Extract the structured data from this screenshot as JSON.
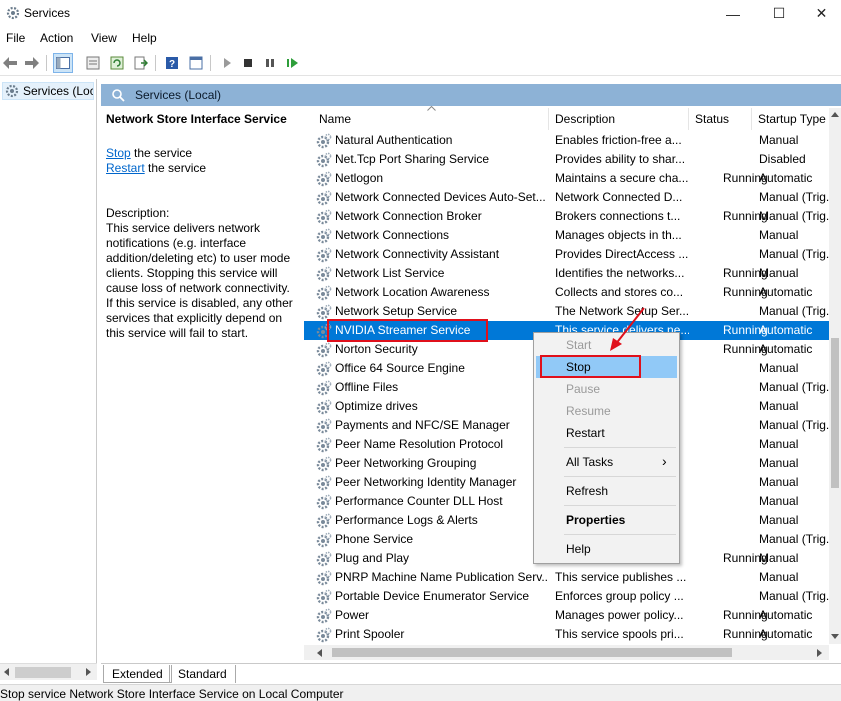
{
  "window": {
    "title": "Services",
    "minimize_glyph": "—",
    "maximize_glyph": "☐",
    "close_glyph": "✕"
  },
  "menu": [
    "File",
    "Action",
    "View",
    "Help"
  ],
  "toolbar": {
    "icons": [
      "back-icon",
      "forward-icon",
      "show-console-tree-icon",
      "properties-icon",
      "refresh-icon",
      "export-list-icon",
      "help-icon",
      "view-icon",
      "start-service-icon",
      "stop-service-icon",
      "pause-service-icon",
      "restart-service-icon"
    ]
  },
  "tree": {
    "item": "Services (Local)"
  },
  "pane_header": {
    "label": "Services (Local)"
  },
  "description": {
    "service_title": "Network Store Interface Service",
    "stop_link": "Stop",
    "stop_suffix": " the service",
    "restart_link": "Restart",
    "restart_suffix": " the service",
    "label": "Description:",
    "text": "This service delivers network notifications (e.g. interface addition/deleting etc) to user mode clients. Stopping this service will cause loss of network connectivity. If this service is disabled, any other services that explicitly depend on this service will fail to start."
  },
  "columns": {
    "name": "Name",
    "description": "Description",
    "status": "Status",
    "startup": "Startup Type"
  },
  "rows": [
    {
      "name": "Natural Authentication",
      "description": "Enables friction-free a...",
      "status": "",
      "startup": "Manual"
    },
    {
      "name": "Net.Tcp Port Sharing Service",
      "description": "Provides ability to shar...",
      "status": "",
      "startup": "Disabled"
    },
    {
      "name": "Netlogon",
      "description": "Maintains a secure cha...",
      "status": "Running",
      "startup": "Automatic"
    },
    {
      "name": "Network Connected Devices Auto-Set...",
      "description": "Network Connected D...",
      "status": "",
      "startup": "Manual (Trig..."
    },
    {
      "name": "Network Connection Broker",
      "description": "Brokers connections t...",
      "status": "Running",
      "startup": "Manual (Trig..."
    },
    {
      "name": "Network Connections",
      "description": "Manages objects in th...",
      "status": "",
      "startup": "Manual"
    },
    {
      "name": "Network Connectivity Assistant",
      "description": "Provides DirectAccess ...",
      "status": "",
      "startup": "Manual (Trig..."
    },
    {
      "name": "Network List Service",
      "description": "Identifies the networks...",
      "status": "Running",
      "startup": "Manual"
    },
    {
      "name": "Network Location Awareness",
      "description": "Collects and stores co...",
      "status": "Running",
      "startup": "Automatic"
    },
    {
      "name": "Network Setup Service",
      "description": "The Network Setup Ser...",
      "status": "",
      "startup": "Manual (Trig..."
    },
    {
      "name": "NVIDIA Streamer Service",
      "description": "This service delivers ne...",
      "status": "Running",
      "startup": "Automatic"
    },
    {
      "name": "Norton Security",
      "description": "",
      "status": "Running",
      "startup": "Automatic"
    },
    {
      "name": "Office 64 Source Engine",
      "description": "",
      "status": "",
      "startup": "Manual"
    },
    {
      "name": "Offline Files",
      "description": "",
      "status": "",
      "startup": "Manual (Trig..."
    },
    {
      "name": "Optimize drives",
      "description": "",
      "status": "",
      "startup": "Manual"
    },
    {
      "name": "Payments and NFC/SE Manager",
      "description": "",
      "status": "",
      "startup": "Manual (Trig..."
    },
    {
      "name": "Peer Name Resolution Protocol",
      "description": "",
      "status": "",
      "startup": "Manual"
    },
    {
      "name": "Peer Networking Grouping",
      "description": "",
      "status": "",
      "startup": "Manual"
    },
    {
      "name": "Peer Networking Identity Manager",
      "description": "",
      "status": "",
      "startup": "Manual"
    },
    {
      "name": "Performance Counter DLL Host",
      "description": "",
      "status": "",
      "startup": "Manual"
    },
    {
      "name": "Performance Logs & Alerts",
      "description": "",
      "status": "",
      "startup": "Manual"
    },
    {
      "name": "Phone Service",
      "description": "",
      "status": "",
      "startup": "Manual (Trig..."
    },
    {
      "name": "Plug and Play",
      "description": "",
      "status": "Running",
      "startup": "Manual"
    },
    {
      "name": "PNRP Machine Name Publication Serv...",
      "description": "This service publishes ...",
      "status": "",
      "startup": "Manual"
    },
    {
      "name": "Portable Device Enumerator Service",
      "description": "Enforces group policy ...",
      "status": "",
      "startup": "Manual (Trig..."
    },
    {
      "name": "Power",
      "description": "Manages power policy...",
      "status": "Running",
      "startup": "Automatic"
    },
    {
      "name": "Print Spooler",
      "description": "This service spools pri...",
      "status": "Running",
      "startup": "Automatic"
    }
  ],
  "selected_row_index": 10,
  "context_menu": {
    "items": [
      {
        "label": "Start",
        "state": "disabled"
      },
      {
        "label": "Stop",
        "state": "hover"
      },
      {
        "label": "Pause",
        "state": "disabled"
      },
      {
        "label": "Resume",
        "state": "disabled"
      },
      {
        "label": "Restart",
        "state": "normal"
      },
      {
        "label": "All Tasks",
        "state": "submenu"
      },
      {
        "label": "Refresh",
        "state": "normal"
      },
      {
        "label": "Properties",
        "state": "bold"
      },
      {
        "label": "Help",
        "state": "normal"
      }
    ],
    "submenu_glyph": "›"
  },
  "tabs": [
    "Extended",
    "Standard"
  ],
  "status_bar": "Stop service Network Store Interface Service on Local Computer",
  "colors": {
    "selection": "#0078d7",
    "menu_hover": "#91c9f7",
    "header_band": "#8db2d6",
    "highlight_red": "#e0101b",
    "link": "#0066cc"
  }
}
